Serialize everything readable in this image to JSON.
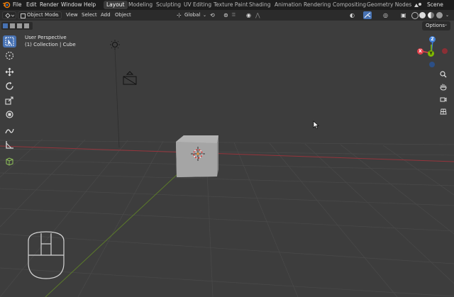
{
  "menu": {
    "items": [
      "File",
      "Edit",
      "Render",
      "Window",
      "Help"
    ]
  },
  "workspaces": {
    "tabs": [
      "Layout",
      "Modeling",
      "Sculpting",
      "UV Editing",
      "Texture Paint",
      "Shading",
      "Animation",
      "Rendering",
      "Compositing",
      "Geometry Nodes"
    ],
    "active": "Layout"
  },
  "scene": {
    "label": "Scene"
  },
  "header": {
    "mode": "Object Mode",
    "view": "View",
    "select": "Select",
    "add": "Add",
    "object": "Object",
    "orientation": "Global"
  },
  "options": {
    "label": "Options"
  },
  "viewport": {
    "perspective": "User Perspective",
    "collection": "(1) Collection | Cube"
  },
  "gizmo": {
    "z": "Z",
    "y": "Y",
    "x": "X"
  },
  "colors": {
    "active_tool": "#4772b3",
    "axis_x": "#e2414b",
    "axis_y": "#7fb800",
    "axis_z": "#3f7fd8",
    "x_line": "#96343c",
    "y_line": "#5b7a2a"
  },
  "icons": [
    "blender-logo-icon",
    "select-box-icon",
    "cursor-icon",
    "move-icon",
    "rotate-icon",
    "scale-icon",
    "transform-icon",
    "annotate-icon",
    "measure-icon",
    "add-cube-icon",
    "zoom-icon",
    "hand-pan-icon",
    "camera-view-icon",
    "grid-view-icon",
    "light-object-icon",
    "camera-object-icon",
    "mouse-hint-icon",
    "mouse-pointer-icon"
  ]
}
